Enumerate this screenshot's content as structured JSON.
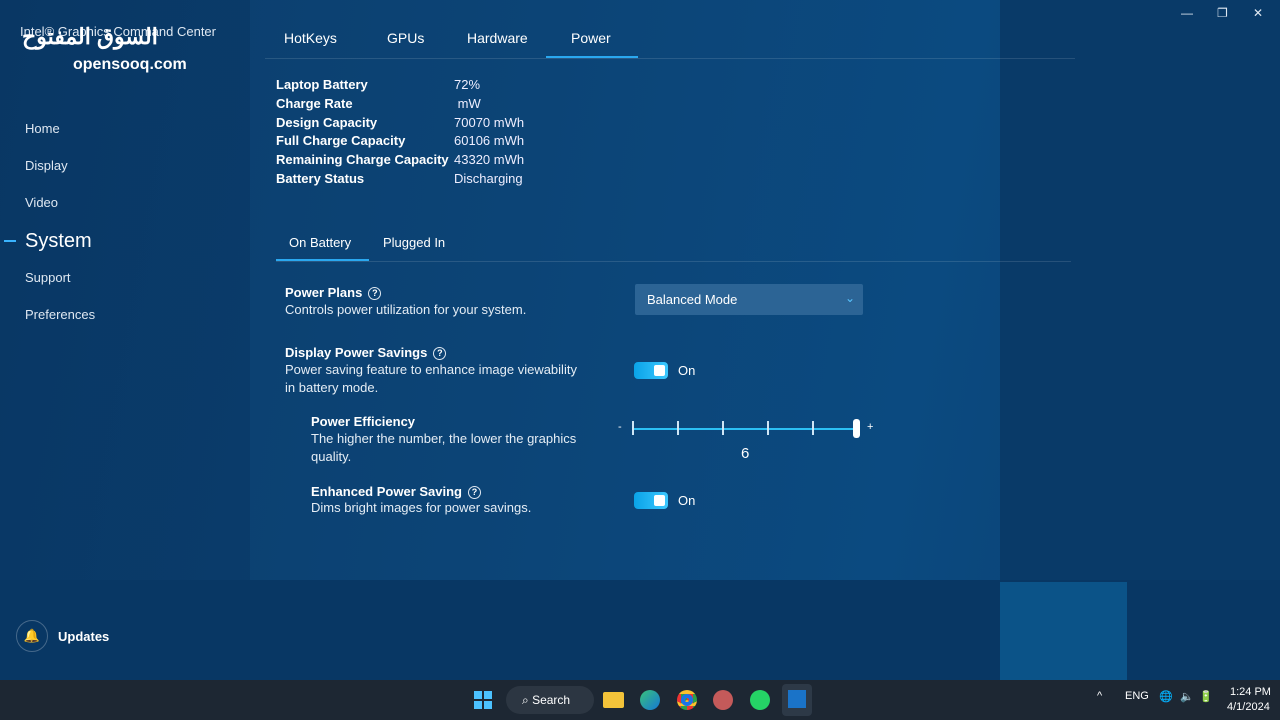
{
  "app": {
    "title": "Intel® Graphics Command Center",
    "watermark_arabic": "السوق المفتوح",
    "watermark": "opensooq.com"
  },
  "window": {
    "minimize": "—",
    "restore": "❐",
    "close": "✕"
  },
  "sidebar": {
    "items": [
      {
        "label": "Home"
      },
      {
        "label": "Display"
      },
      {
        "label": "Video"
      },
      {
        "label": "System",
        "active": true
      },
      {
        "label": "Support"
      },
      {
        "label": "Preferences"
      }
    ],
    "updates": "Updates"
  },
  "tabs": [
    {
      "label": "HotKeys"
    },
    {
      "label": "GPUs"
    },
    {
      "label": "Hardware"
    },
    {
      "label": "Power",
      "active": true
    }
  ],
  "battery": [
    {
      "label": "Laptop Battery",
      "value": "72%"
    },
    {
      "label": "Charge Rate",
      "value": " mW"
    },
    {
      "label": "Design Capacity",
      "value": "70070 mWh"
    },
    {
      "label": "Full Charge Capacity",
      "value": "60106 mWh"
    },
    {
      "label": "Remaining Charge Capacity",
      "value": "43320 mWh"
    },
    {
      "label": "Battery Status",
      "value": "Discharging"
    }
  ],
  "subtabs": [
    {
      "label": "On Battery",
      "active": true
    },
    {
      "label": "Plugged In"
    }
  ],
  "settings": {
    "power_plans": {
      "title": "Power Plans",
      "desc": "Controls power utilization for your system.",
      "value": "Balanced Mode"
    },
    "display_power_savings": {
      "title": "Display Power Savings",
      "desc1": "Power saving feature to enhance image viewability",
      "desc2": "in battery mode.",
      "state": "On",
      "on": true
    },
    "power_efficiency": {
      "title": "Power Efficiency",
      "desc1": "The higher the number, the lower the graphics",
      "desc2": "quality.",
      "min_label": "-",
      "max_label": "+",
      "value": "6",
      "min": 1,
      "max": 6
    },
    "enhanced_power_saving": {
      "title": "Enhanced Power Saving",
      "desc": "Dims bright images for power savings.",
      "state": "On",
      "on": true
    }
  },
  "taskbar": {
    "search": "Search",
    "lang": "ENG",
    "time": "1:24 PM",
    "date": "4/1/2024"
  },
  "colors": {
    "accent": "#2aa8f0",
    "toggle": "#1bb6f5"
  }
}
